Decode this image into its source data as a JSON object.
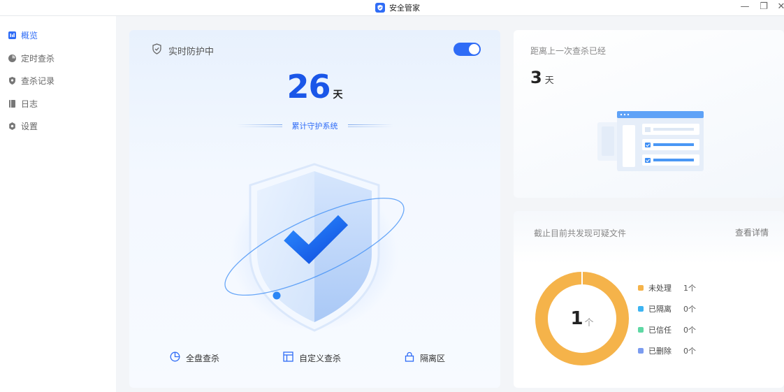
{
  "app": {
    "title": "安全管家"
  },
  "window": {
    "minimize_glyph": "—",
    "restore_glyph": "❐",
    "close_glyph": "✕"
  },
  "sidebar": {
    "items": [
      {
        "label": "概览",
        "icon": "chart-bar-icon",
        "active": true
      },
      {
        "label": "定时查杀",
        "icon": "clock-pie-icon",
        "active": false
      },
      {
        "label": "查杀记录",
        "icon": "shield-record-icon",
        "active": false
      },
      {
        "label": "日志",
        "icon": "log-book-icon",
        "active": false
      },
      {
        "label": "设置",
        "icon": "gear-icon",
        "active": false
      }
    ]
  },
  "protection": {
    "label": "实时防护中",
    "toggle_on": true,
    "days": "26",
    "days_unit": "天",
    "subtitle": "累计守护系统"
  },
  "actions": [
    {
      "label": "全盘查杀",
      "icon": "pie-scan-icon"
    },
    {
      "label": "自定义查杀",
      "icon": "layout-panel-icon"
    },
    {
      "label": "隔离区",
      "icon": "lock-icon"
    }
  ],
  "last_scan": {
    "title": "距离上一次查杀已经",
    "value": "3",
    "unit": "天"
  },
  "files": {
    "title": "截止目前共发现可疑文件",
    "detail_link": "查看详情",
    "total": "1",
    "unit": "个",
    "legend": [
      {
        "label": "未处理",
        "count": "1个",
        "value": 1,
        "color": "#f5b34a"
      },
      {
        "label": "已隔离",
        "count": "0个",
        "value": 0,
        "color": "#3db4f2"
      },
      {
        "label": "已信任",
        "count": "0个",
        "value": 0,
        "color": "#5fd8a4"
      },
      {
        "label": "已删除",
        "count": "0个",
        "value": 0,
        "color": "#7b9cf0"
      }
    ]
  },
  "colors": {
    "accent": "#2f6cf6",
    "donut": "#f5b34a"
  }
}
